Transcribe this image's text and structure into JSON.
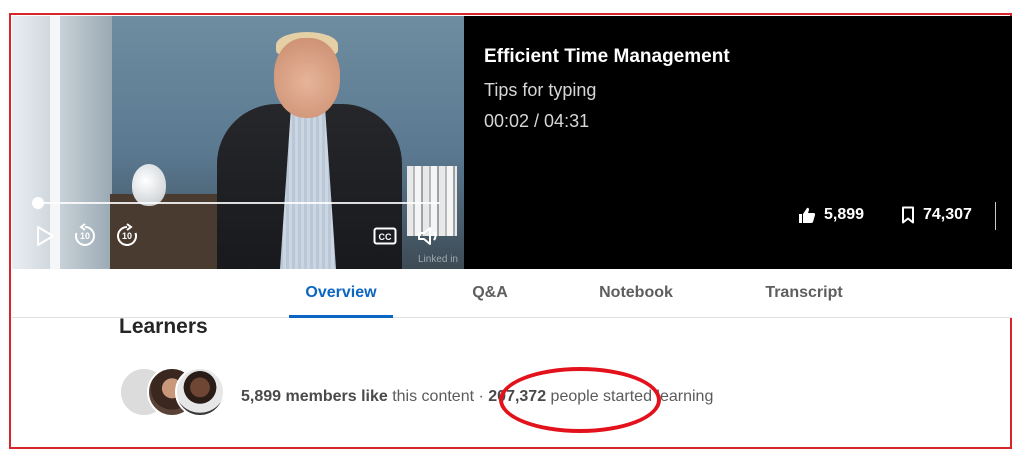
{
  "course": {
    "title": "Efficient Time Management",
    "lesson": "Tips for typing",
    "time": "00:02 / 04:31",
    "likes": "5,899",
    "saves": "74,307"
  },
  "player": {
    "progress_fraction": 0.007,
    "controls": [
      "play-icon",
      "skip-back-10-icon",
      "skip-forward-10-icon",
      "closed-captions-icon",
      "volume-icon"
    ],
    "rewind_label": "10",
    "forward_label": "10",
    "cc_label": "CC",
    "watermark": "Linked in"
  },
  "tabs": [
    {
      "label": "Overview",
      "active": true
    },
    {
      "label": "Q&A",
      "active": false
    },
    {
      "label": "Notebook",
      "active": false
    },
    {
      "label": "Transcript",
      "active": false
    }
  ],
  "learners": {
    "heading": "Learners",
    "members_like_count": "5,899 members like",
    "members_like_suffix": " this content",
    "separator": " · ",
    "started_count": "207,372",
    "started_suffix": " people started learning"
  },
  "colors": {
    "accent": "#0a66c2",
    "annotation_red": "#e3111b",
    "frame_red": "#d7262b"
  }
}
